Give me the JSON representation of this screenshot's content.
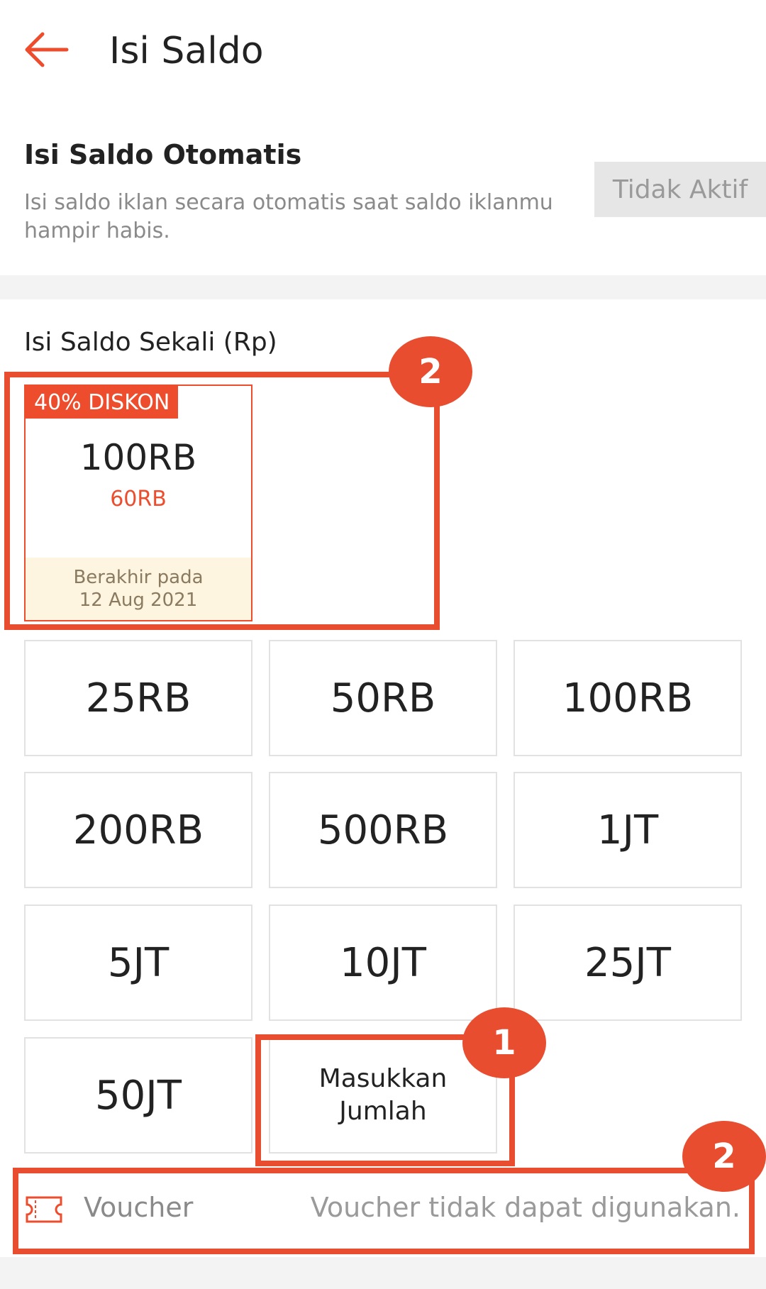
{
  "header": {
    "title": "Isi Saldo"
  },
  "auto_topup": {
    "title": "Isi Saldo Otomatis",
    "description": "Isi saldo iklan secara otomatis saat saldo iklanmu hampir habis.",
    "toggle_label": "Tidak Aktif"
  },
  "one_time": {
    "label": "Isi Saldo Sekali (Rp)",
    "promo": {
      "badge": "40% DISKON",
      "amount": "100RB",
      "price": "60RB",
      "expiry_label": "Berakhir pada",
      "expiry_date": "12 Aug 2021"
    },
    "amounts": [
      "25RB",
      "50RB",
      "100RB",
      "200RB",
      "500RB",
      "1JT",
      "5JT",
      "10JT",
      "25JT",
      "50JT"
    ],
    "custom_line1": "Masukkan",
    "custom_line2": "Jumlah"
  },
  "voucher": {
    "label": "Voucher",
    "status": "Voucher tidak dapat digunakan."
  },
  "annotations": {
    "one": "1",
    "two": "2"
  },
  "colors": {
    "accent": "#ee4d2d",
    "annotation": "#e84d30"
  }
}
